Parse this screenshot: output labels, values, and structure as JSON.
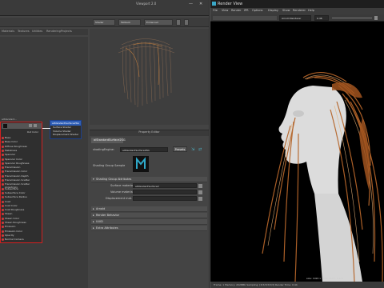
{
  "maya": {
    "window_title": "Viewport 2.0",
    "minimize": "—",
    "close": "✕",
    "hs_toolbar": [
      "Shader",
      "Fallback",
      "Optional",
      "Enhanced"
    ],
    "hs_tabs": [
      "Materials",
      "Textures",
      "Utilities",
      "Rendering",
      "Projects",
      "Asset Nodes"
    ],
    "node_title": "aiStandardSurface",
    "node_header": "aiStandard...",
    "out_color": "Out Color",
    "attributes": [
      "Base",
      "Base Color",
      "Diffuse Roughness",
      "Metalness",
      "Specular",
      "Specular Color",
      "Specular Roughness",
      "Transmission",
      "Transmission Color",
      "Transmission Depth",
      "Transmission Scatter",
      "Transmission Scatter Anisotropy",
      "Subsurface",
      "Subsurface Color",
      "Subsurface Radius",
      "Coat",
      "Coat Color",
      "Coat Roughness",
      "Sheen",
      "Sheen Color",
      "Sheen Roughness",
      "Emission",
      "Emission Color",
      "Opacity",
      "Normal Camera"
    ],
    "sg_title": "aiStandardSurface2SG",
    "sg_items": [
      "Surface Shader",
      "Volume Shader",
      "Displacement Shader"
    ],
    "pe": {
      "title": "Property Editor",
      "tab": "aiStandardSurface2SG",
      "shading_engine_label": "shadingEngine:",
      "shading_engine_value": "aiStandardSurface2SG",
      "presets": "Presets",
      "sample_label": "Shading Group Sample",
      "sections": [
        "Shading Group Attributes",
        "Arnold",
        "Render Behavior",
        "UUID",
        "Extra Attributes"
      ],
      "surface_label": "Surface material",
      "surface_value": "aiStandardSurface2",
      "volume_label": "Volume material",
      "volume_value": "",
      "displacement_label": "Displacement mat.",
      "displacement_value": ""
    }
  },
  "render_view": {
    "title": "Render View",
    "menu": [
      "File",
      "View",
      "Render",
      "IPR",
      "Options",
      "Display",
      "Show",
      "Renderer",
      "Help"
    ],
    "camera": "Arnold Renderer",
    "exposure": "0.46",
    "size_info": "size: 1920 x 1080  zoom: 0.471",
    "status": "Frame: 1  Memory: 2028Mb  Sampling: [3/3/3/3/3/3]  Render Time: 0:44"
  }
}
